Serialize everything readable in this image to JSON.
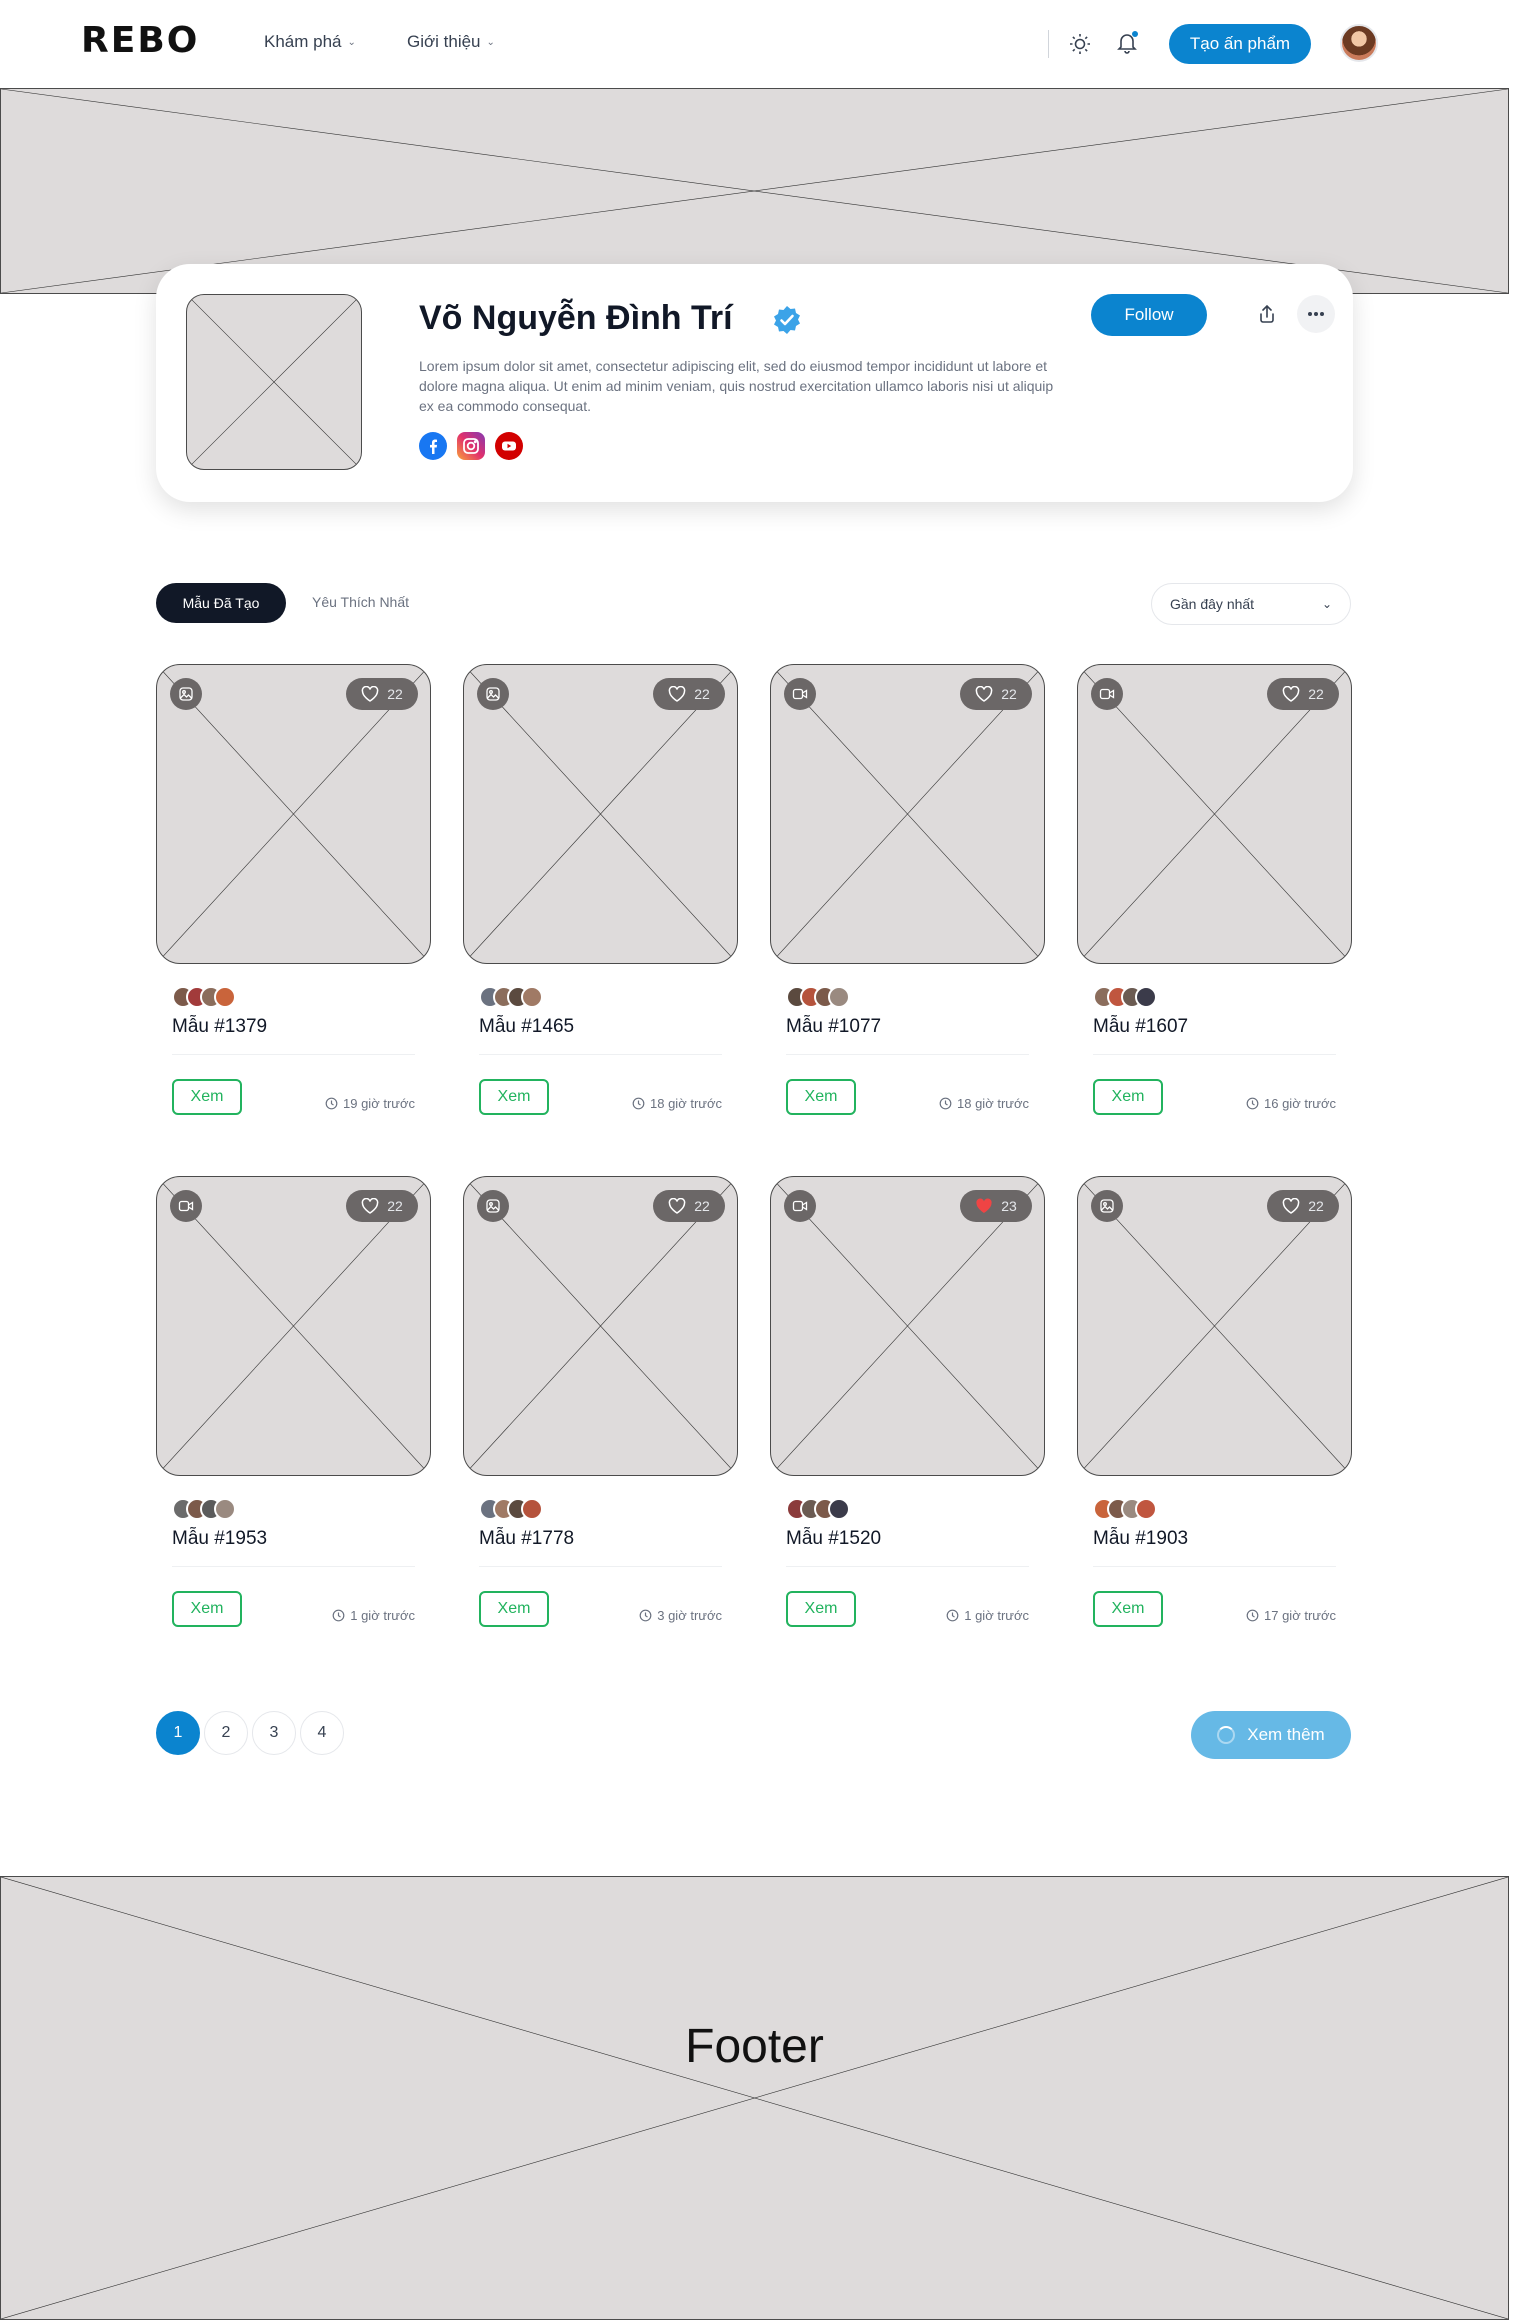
{
  "header": {
    "logo": "REBO",
    "nav": [
      {
        "label": "Khám phá"
      },
      {
        "label": "Giới thiệu"
      }
    ],
    "create_label": "Tạo ấn phẩm",
    "icons": [
      "sun-icon",
      "bell-icon"
    ]
  },
  "profile": {
    "name": "Võ Nguyễn Đình Trí",
    "bio": "Lorem ipsum dolor sit amet, consectetur adipiscing elit, sed do eiusmod tempor incididunt ut labore et dolore magna aliqua. Ut enim ad minim veniam, quis nostrud exercitation ullamco laboris nisi ut aliquip ex ea commodo consequat.",
    "follow_label": "Follow",
    "socials": [
      "facebook-icon",
      "instagram-icon",
      "youtube-icon"
    ]
  },
  "tabs": {
    "active": "Mẫu Đã Tạo",
    "other": "Yêu Thích Nhất",
    "sort_label": "Gần đây nhất"
  },
  "cards": [
    {
      "title": "Mẫu #1379",
      "likes": "22",
      "time": "19 giờ trước",
      "button": "Xem",
      "type": "image",
      "liked": false
    },
    {
      "title": "Mẫu #1465",
      "likes": "22",
      "time": "18 giờ trước",
      "button": "Xem",
      "type": "image",
      "liked": false
    },
    {
      "title": "Mẫu #1077",
      "likes": "22",
      "time": "18 giờ trước",
      "button": "Xem",
      "type": "video",
      "liked": false
    },
    {
      "title": "Mẫu #1607",
      "likes": "22",
      "time": "16 giờ trước",
      "button": "Xem",
      "type": "video",
      "liked": false
    },
    {
      "title": "Mẫu #1953",
      "likes": "22",
      "time": "1 giờ trước",
      "button": "Xem",
      "type": "video",
      "liked": false
    },
    {
      "title": "Mẫu #1778",
      "likes": "22",
      "time": "3 giờ trước",
      "button": "Xem",
      "type": "image",
      "liked": false
    },
    {
      "title": "Mẫu #1520",
      "likes": "23",
      "time": "1 giờ trước",
      "button": "Xem",
      "type": "video",
      "liked": true
    },
    {
      "title": "Mẫu #1903",
      "likes": "22",
      "time": "17 giờ trước",
      "button": "Xem",
      "type": "image",
      "liked": false
    }
  ],
  "pagination": {
    "pages": [
      "1",
      "2",
      "3",
      "4"
    ],
    "current": "1",
    "more_label": "Xem thêm"
  },
  "footer": {
    "label": "Footer"
  },
  "colors": {
    "primary": "#0b84cf",
    "accent_green": "#22b35e",
    "placeholder": "#dedbdb",
    "like_red": "#ef4444"
  }
}
